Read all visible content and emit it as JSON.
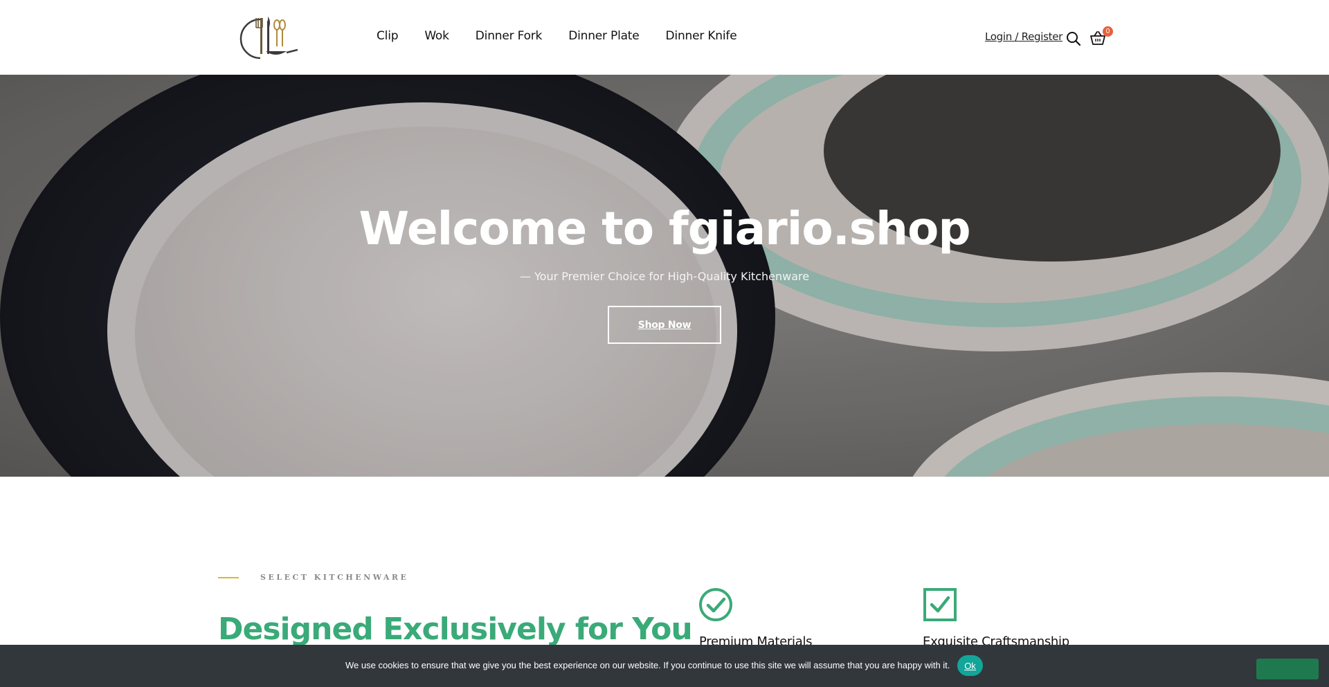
{
  "header": {
    "logo_icon": "cutlery-logo-icon",
    "nav": [
      "Clip",
      "Wok",
      "Dinner Fork",
      "Dinner Plate",
      "Dinner Knife"
    ],
    "account_label": "Login / Register",
    "search_icon": "search-icon",
    "cart_icon": "basket-icon",
    "cart_count": "0"
  },
  "hero": {
    "title": "Welcome to fgiario.shop",
    "subtitle": "— Your Premier Choice for High-Quality Kitchenware",
    "button_label": "Shop Now"
  },
  "intro": {
    "eyebrow": "SELECT KITCHENWARE",
    "title": "Designed Exclusively for You",
    "features": [
      {
        "icon": "check-circle-icon",
        "title": "Premium Materials"
      },
      {
        "icon": "check-square-icon",
        "title": "Exquisite Craftsmanship"
      }
    ]
  },
  "cookie": {
    "message": "We use cookies to ensure that we give you the best experience on our website. If you continue to use this site we will assume that you are happy with it.",
    "ok_label": "Ok"
  },
  "colors": {
    "accent_green": "#3aaa78",
    "eyebrow_gold": "#e0b526",
    "cart_badge": "#e8613c",
    "cookie_bg": "#32373c",
    "cookie_ok": "#13a59a"
  }
}
